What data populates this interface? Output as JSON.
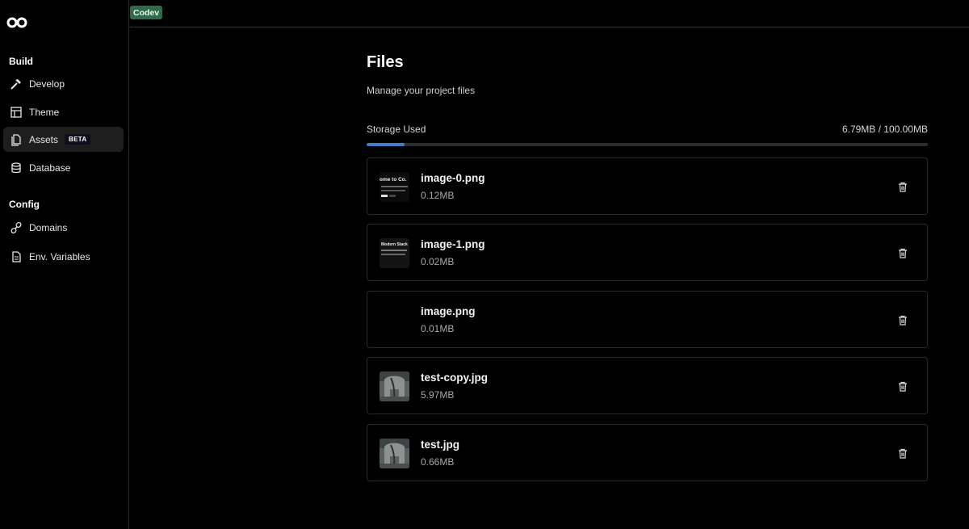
{
  "brand": {
    "logo_icon": "infinity-co-logo-icon"
  },
  "topbar": {
    "badge": "Codev"
  },
  "sidebar": {
    "sections": [
      {
        "title": "Build",
        "items": [
          {
            "label": "Develop",
            "icon": "hammer-icon"
          },
          {
            "label": "Theme",
            "icon": "layout-icon"
          },
          {
            "label": "Assets",
            "icon": "files-icon",
            "badge": "BETA",
            "active": true
          },
          {
            "label": "Database",
            "icon": "database-icon"
          }
        ]
      },
      {
        "title": "Config",
        "items": [
          {
            "label": "Domains",
            "icon": "link-icon"
          },
          {
            "label": "Env. Variables",
            "icon": "file-icon"
          }
        ]
      }
    ]
  },
  "main": {
    "title": "Files",
    "subtitle": "Manage your project files",
    "storage": {
      "label": "Storage Used",
      "value_text": "6.79MB / 100.00MB",
      "used_mb": 6.79,
      "total_mb": 100.0,
      "bar_color": "#3e7ec8"
    },
    "files": [
      {
        "name": "image-0.png",
        "size": "0.12MB",
        "thumb": "screenshot",
        "thumb_text": "ome to Co."
      },
      {
        "name": "image-1.png",
        "size": "0.02MB",
        "thumb": "screenshot",
        "thumb_text": "Modern Stack"
      },
      {
        "name": "image.png",
        "size": "0.01MB",
        "thumb": "blank"
      },
      {
        "name": "test-copy.jpg",
        "size": "5.97MB",
        "thumb": "photo"
      },
      {
        "name": "test.jpg",
        "size": "0.66MB",
        "thumb": "photo"
      }
    ]
  }
}
